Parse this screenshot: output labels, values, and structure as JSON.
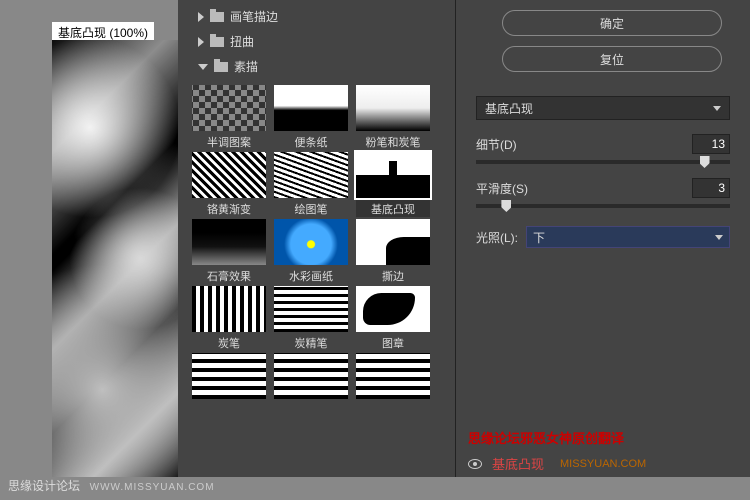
{
  "preview": {
    "title": "基底凸现 (100%)"
  },
  "categories": [
    {
      "label": "画笔描边",
      "expanded": false
    },
    {
      "label": "扭曲",
      "expanded": false
    },
    {
      "label": "素描",
      "expanded": true
    }
  ],
  "thumbs": [
    {
      "label": "半调图案"
    },
    {
      "label": "便条纸"
    },
    {
      "label": "粉笔和炭笔"
    },
    {
      "label": "铬黄渐变"
    },
    {
      "label": "绘图笔"
    },
    {
      "label": "基底凸现",
      "selected": true
    },
    {
      "label": "石膏效果"
    },
    {
      "label": "水彩画纸"
    },
    {
      "label": "撕边"
    },
    {
      "label": "炭笔"
    },
    {
      "label": "炭精笔"
    },
    {
      "label": "图章"
    },
    {
      "label": ""
    },
    {
      "label": ""
    },
    {
      "label": ""
    }
  ],
  "buttons": {
    "ok": "确定",
    "reset": "复位"
  },
  "filter_dropdown": {
    "value": "基底凸现"
  },
  "sliders": {
    "detail": {
      "label": "细节(D)",
      "value": "13",
      "pos": 88
    },
    "smooth": {
      "label": "平滑度(S)",
      "value": "3",
      "pos": 10
    }
  },
  "light": {
    "label": "光照(L):",
    "value": "下"
  },
  "watermark": "思缘论坛邪恶女神原创翻译",
  "layer": {
    "name": "基底凸现",
    "url": "MISSYUAN.COM"
  },
  "footer": {
    "site": "思缘设计论坛",
    "url": "WWW.MISSYUAN.COM"
  }
}
